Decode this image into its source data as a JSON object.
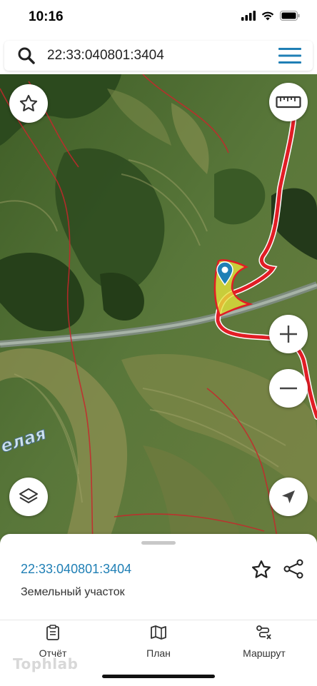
{
  "status": {
    "time": "10:16"
  },
  "search": {
    "query": "22:33:040801:3404"
  },
  "map": {
    "place_label": "елая",
    "accent": "#e11d25",
    "parcel_fill": "#e4e23c"
  },
  "sheet": {
    "title": "22:33:040801:3404",
    "subtitle": "Земельный участок"
  },
  "tabs": [
    {
      "label": "Отчёт",
      "icon": "report-icon"
    },
    {
      "label": "План",
      "icon": "map-plan-icon"
    },
    {
      "label": "Маршрут",
      "icon": "route-icon"
    }
  ],
  "watermark": "Tophlab",
  "colors": {
    "link": "#1f7fb5",
    "menu": "#1f7fb5"
  }
}
